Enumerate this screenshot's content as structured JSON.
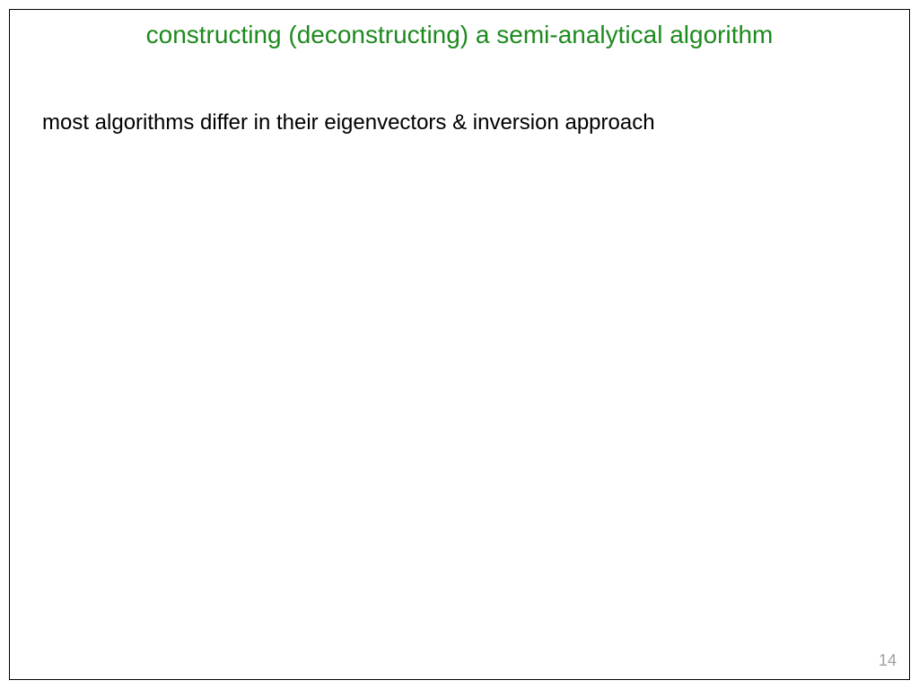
{
  "slide": {
    "title": "constructing (deconstructing) a semi-analytical algorithm",
    "body": "most algorithms differ in their eigenvectors & inversion approach",
    "page_number": "14"
  }
}
